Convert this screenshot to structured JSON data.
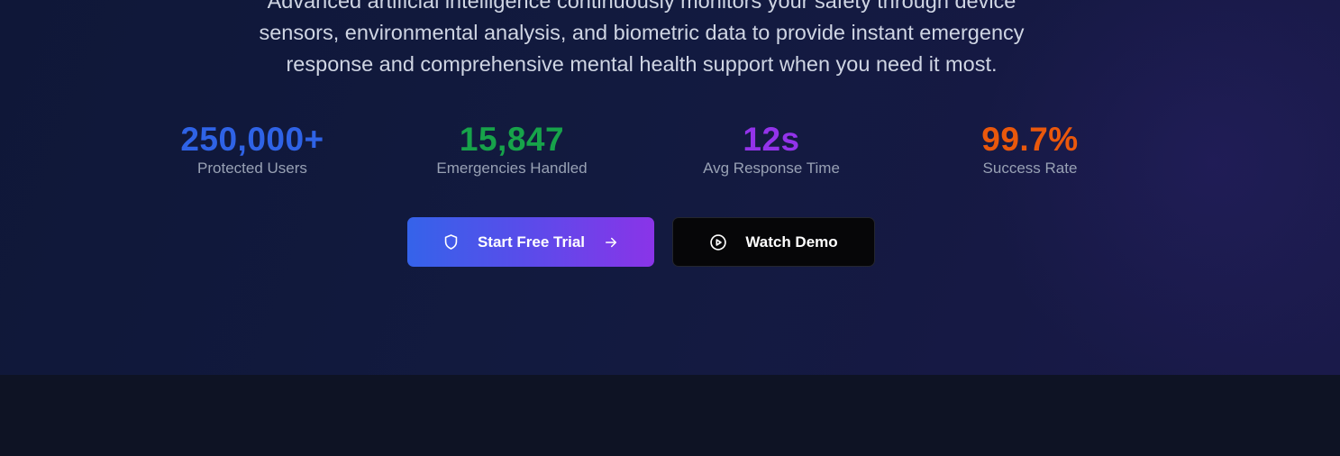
{
  "hero": {
    "description_lines": [
      "Advanced artificial intelligence continuously monitors your safety through device",
      "sensors, environmental analysis, and biometric data to provide instant emergency",
      "response and comprehensive mental health support when you need it most."
    ],
    "stats": [
      {
        "value": "250,000+",
        "label": "Protected Users",
        "color": "#2f63e6"
      },
      {
        "value": "15,847",
        "label": "Emergencies Handled",
        "color": "#17a34a"
      },
      {
        "value": "12s",
        "label": "Avg Response Time",
        "color": "#9333ea"
      },
      {
        "value": "99.7%",
        "label": "Success Rate",
        "color": "#ea580c"
      }
    ],
    "primary_button": {
      "label": "Start Free Trial",
      "icon": "shield-icon",
      "trailing_icon": "arrow-right-icon"
    },
    "secondary_button": {
      "label": "Watch Demo",
      "icon": "play-circle-icon"
    }
  },
  "colors": {
    "hero_background": "#121a3f",
    "lower_background": "#0e1324",
    "primary_gradient_start": "#3563ea",
    "primary_gradient_end": "#8a34e8"
  }
}
